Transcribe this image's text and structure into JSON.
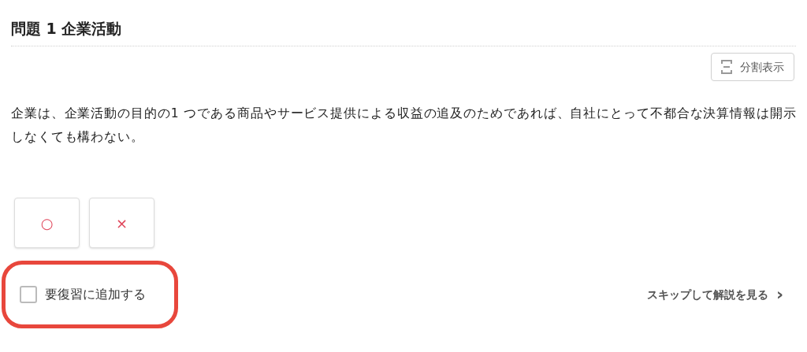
{
  "title": "問題 1 企業活動",
  "split_button": {
    "label": "分割表示"
  },
  "question": "企業は、企業活動の目的の1 つである商品やサービス提供による収益の追及のためであれば、自社にとって不都合な決算情報は開示しなくても構わない。",
  "answers": [
    {
      "label": "○",
      "selected": false
    },
    {
      "label": "×",
      "selected": false
    }
  ],
  "review_checkbox": {
    "label": "要復習に追加する",
    "checked": false,
    "highlighted": true
  },
  "skip_link": {
    "label": "スキップして解説を見る",
    "arrow": "›"
  }
}
